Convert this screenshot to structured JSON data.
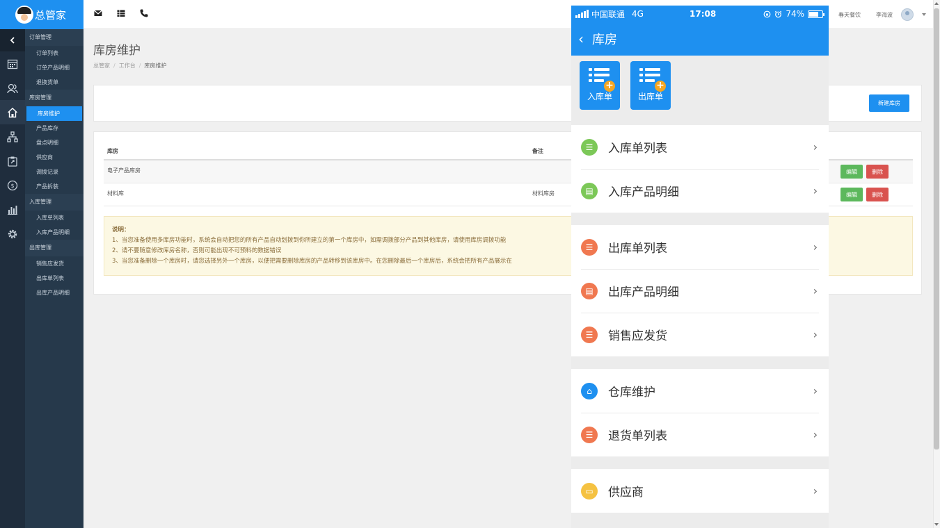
{
  "app": {
    "name": "总管家"
  },
  "submenu": [
    {
      "group": "订单管理",
      "items": [
        "订单列表",
        "订单产品明细",
        "退换货单"
      ]
    },
    {
      "group": "库房管理",
      "items": [
        "库房维护",
        "产品库存",
        "盘点明细",
        "供应商",
        "调拨记录",
        "产品拆装"
      ]
    },
    {
      "group": "入库管理",
      "items": [
        "入库单列表",
        "入库产品明细"
      ]
    },
    {
      "group": "出库管理",
      "items": [
        "销售应发货",
        "出库单列表",
        "出库产品明细"
      ]
    }
  ],
  "active_submenu": "库房维护",
  "header": {
    "company": "春天餐饮",
    "user": "李海波"
  },
  "page": {
    "title": "库房维护",
    "breadcrumb": [
      "总管家",
      "工作台",
      "库房维护"
    ],
    "new_button": "新建库房"
  },
  "table": {
    "columns": [
      "库房",
      "备注"
    ],
    "rows": [
      {
        "name": "电子产品库房",
        "note": ""
      },
      {
        "name": "材料库",
        "note": "材料库房"
      }
    ],
    "edit_label": "编辑",
    "delete_label": "删除"
  },
  "notice": {
    "title": "说明：",
    "lines": [
      "1、当您准备使用多库房功能时，系统会自动把您的所有产品自动划拨到你所建立的第一个库房中，如需调拨部分产品到其他库房，请使用库房调拨功能",
      "2、请不要随意修改库房名称，否则可能出现不可预料的数据错误",
      "3、当您准备删除一个库房时，请您选择另外一个库房，以便把需要删除库房的产品转移到该库房中。在您删除最后一个库房后，系统会把所有产品展示在"
    ]
  },
  "phone": {
    "status": {
      "carrier": "中国联通",
      "network": "4G",
      "time": "17:08",
      "battery": "74%",
      "battery_level": 0.74
    },
    "title": "库房",
    "quick_actions": [
      "入库单",
      "出库单"
    ],
    "groups": [
      [
        {
          "label": "入库单列表",
          "color": "#7cc858",
          "icon": "list-icon"
        },
        {
          "label": "入库产品明细",
          "color": "#7cc858",
          "icon": "detail-icon"
        }
      ],
      [
        {
          "label": "出库单列表",
          "color": "#f07850",
          "icon": "list-icon"
        },
        {
          "label": "出库产品明细",
          "color": "#f07850",
          "icon": "detail-icon"
        },
        {
          "label": "销售应发货",
          "color": "#f07850",
          "icon": "list-icon"
        }
      ],
      [
        {
          "label": "仓库维护",
          "color": "#1e90f0",
          "icon": "home-icon"
        },
        {
          "label": "退货单列表",
          "color": "#f07850",
          "icon": "list-icon"
        }
      ],
      [
        {
          "label": "供应商",
          "color": "#f5c242",
          "icon": "card-icon"
        }
      ]
    ]
  },
  "colors": {
    "primary": "#1e90f0",
    "sidebar": "#1f2d3d",
    "submenu": "#26394b",
    "success": "#5cb85c",
    "danger": "#d9534f"
  }
}
